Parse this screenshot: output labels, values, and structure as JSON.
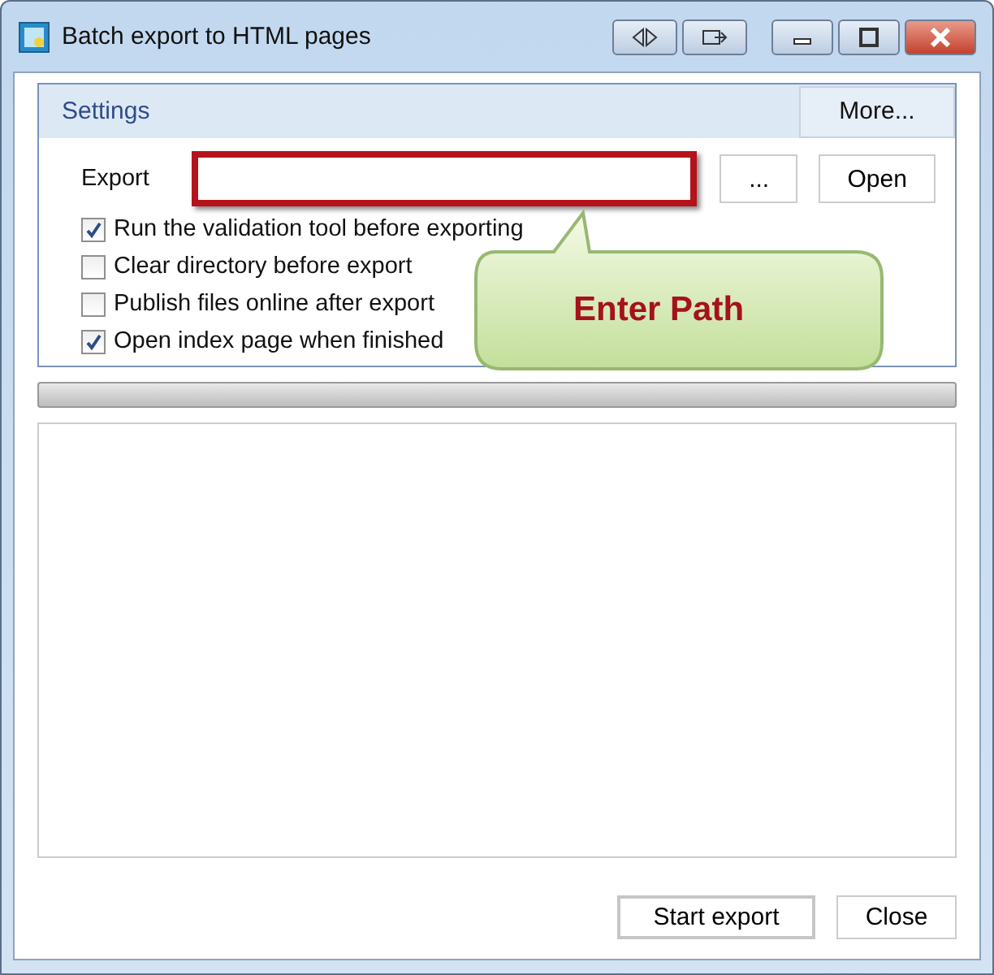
{
  "window": {
    "title": "Batch export to HTML pages"
  },
  "settings": {
    "title": "Settings",
    "more_button": "More...",
    "export_label": "Export",
    "browse_button": "...",
    "open_button": "Open",
    "options": [
      {
        "label": "Run the validation tool before exporting",
        "checked": true
      },
      {
        "label": "Clear directory before export",
        "checked": false
      },
      {
        "label": "Publish files online after export",
        "checked": false
      },
      {
        "label": "Open index page when finished",
        "checked": true
      }
    ]
  },
  "progress": {
    "level": 0
  },
  "callout": {
    "text": "Enter Path"
  },
  "buttons": [
    {
      "label": "Start export",
      "default": true
    },
    {
      "label": "Close",
      "default": false
    }
  ]
}
